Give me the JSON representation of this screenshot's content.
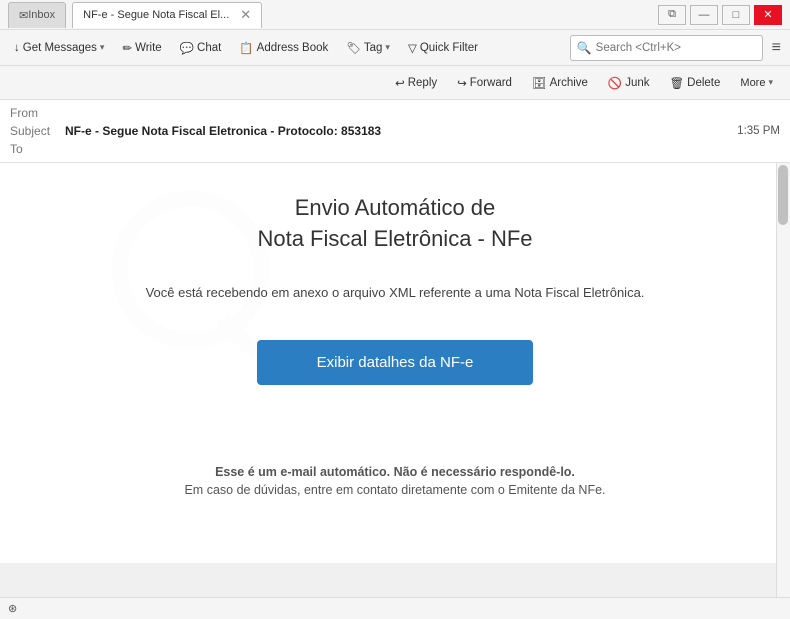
{
  "titlebar": {
    "tab_inactive": "Inbox",
    "tab_active_label": "NF-e - Segue Nota Fiscal El...",
    "win_btn_minimize": "—",
    "win_btn_maximize": "□",
    "win_btn_close": "✕"
  },
  "toolbar": {
    "get_messages": "Get Messages",
    "write": "Write",
    "chat": "Chat",
    "address_book": "Address Book",
    "tag": "Tag",
    "quick_filter": "Quick Filter",
    "search_placeholder": "Search <Ctrl+K>",
    "menu_icon": "≡"
  },
  "email_actions": {
    "reply": "Reply",
    "forward": "Forward",
    "archive": "Archive",
    "junk": "Junk",
    "delete": "Delete",
    "more": "More"
  },
  "email_meta": {
    "from_label": "From",
    "subject_label": "Subject",
    "subject_value": "NF-e - Segue Nota Fiscal Eletronica - Protocolo: 853183",
    "to_label": "To",
    "time": "1:35 PM"
  },
  "email_body": {
    "title_line1": "Envio Automático de",
    "title_line2": "Nota Fiscal Eletrônica - NFe",
    "body_text": "Você está recebendo em anexo o arquivo XML referente a uma Nota Fiscal Eletrônica.",
    "cta_button": "Exibir datalhes da NF-e",
    "footer_line1": "Esse é um e-mail automático. Não é necessário respondê-lo.",
    "footer_line2": "Em caso de dúvidas, entre em contato diretamente com o Emitente da NFe."
  },
  "statusbar": {
    "icon": "⊛"
  }
}
